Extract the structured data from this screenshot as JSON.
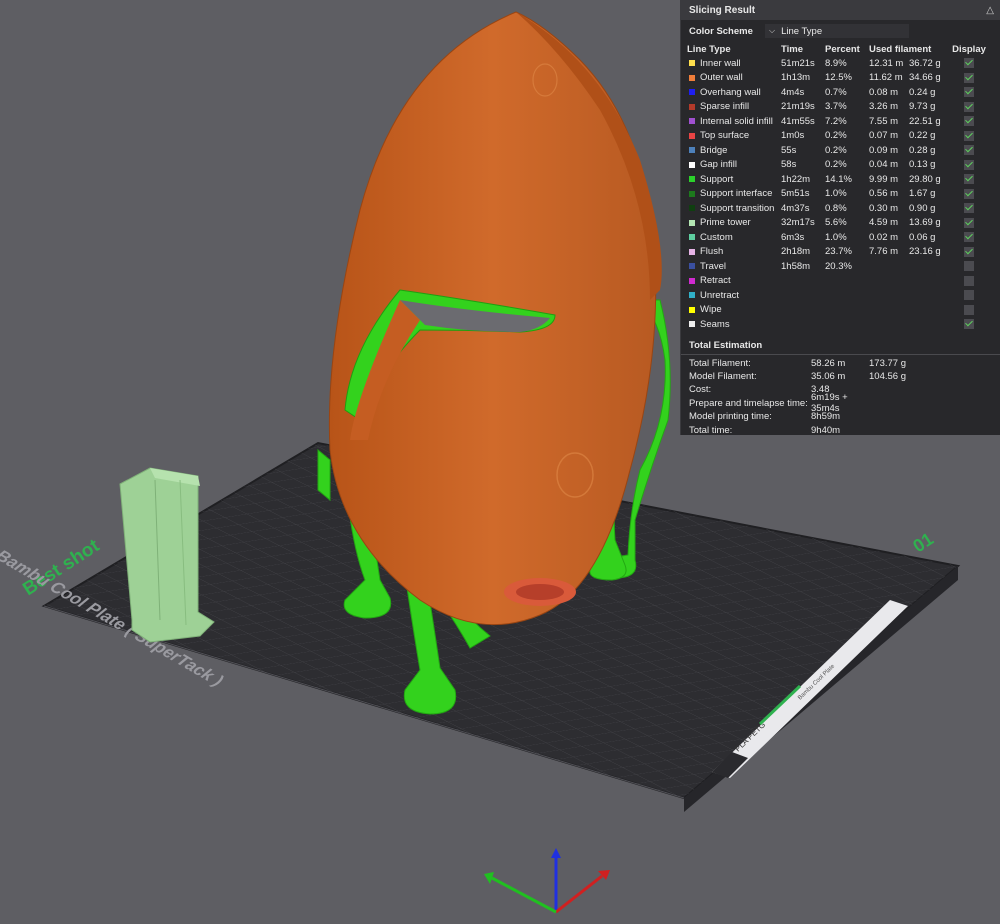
{
  "viewport": {
    "plate_brand_text": "Bambu Cool Plate ( SuperTack )",
    "plate_label": "Best shot",
    "plate_number": "01",
    "plate_sticker_text": "PLA PETG",
    "plate_sticker_small_text": "Bambu Cool Plate",
    "colors": {
      "background": "#5e5e63",
      "bed": "#2d2d31",
      "model_orange": "#c85f22",
      "support_green": "#33d21d",
      "prime_tower": "#9ed196",
      "label_green": "#2fb14f"
    }
  },
  "panel": {
    "title": "Slicing Result",
    "collapse_icon": "chevron-up-icon",
    "color_scheme_label": "Color Scheme",
    "color_scheme_value": "Line Type",
    "columns": [
      "Line Type",
      "Time",
      "Percent",
      "Used filament",
      "Display"
    ],
    "rows": [
      {
        "name": "Inner wall",
        "time": "51m21s",
        "percent": "8.9%",
        "used_m": "12.31 m",
        "used_g": "36.72 g",
        "color": "#ffdf4e",
        "display": true
      },
      {
        "name": "Outer wall",
        "time": "1h13m",
        "percent": "12.5%",
        "used_m": "11.62 m",
        "used_g": "34.66 g",
        "color": "#f07e3a",
        "display": true
      },
      {
        "name": "Overhang wall",
        "time": "4m4s",
        "percent": "0.7%",
        "used_m": "0.08 m",
        "used_g": "0.24 g",
        "color": "#1f1ff0",
        "display": true
      },
      {
        "name": "Sparse infill",
        "time": "21m19s",
        "percent": "3.7%",
        "used_m": "3.26 m",
        "used_g": "9.73 g",
        "color": "#b33a2a",
        "display": true
      },
      {
        "name": "Internal solid infill",
        "time": "41m55s",
        "percent": "7.2%",
        "used_m": "7.55 m",
        "used_g": "22.51 g",
        "color": "#a050d0",
        "display": true
      },
      {
        "name": "Top surface",
        "time": "1m0s",
        "percent": "0.2%",
        "used_m": "0.07 m",
        "used_g": "0.22 g",
        "color": "#e84444",
        "display": true
      },
      {
        "name": "Bridge",
        "time": "55s",
        "percent": "0.2%",
        "used_m": "0.09 m",
        "used_g": "0.28 g",
        "color": "#4d80ba",
        "display": true
      },
      {
        "name": "Gap infill",
        "time": "58s",
        "percent": "0.2%",
        "used_m": "0.04 m",
        "used_g": "0.13 g",
        "color": "#ffffff",
        "display": true
      },
      {
        "name": "Support",
        "time": "1h22m",
        "percent": "14.1%",
        "used_m": "9.99 m",
        "used_g": "29.80 g",
        "color": "#2bd12b",
        "display": true
      },
      {
        "name": "Support interface",
        "time": "5m51s",
        "percent": "1.0%",
        "used_m": "0.56 m",
        "used_g": "1.67 g",
        "color": "#1d7a1d",
        "display": true
      },
      {
        "name": "Support transition",
        "time": "4m37s",
        "percent": "0.8%",
        "used_m": "0.30 m",
        "used_g": "0.90 g",
        "color": "#0f3f10",
        "display": true
      },
      {
        "name": "Prime tower",
        "time": "32m17s",
        "percent": "5.6%",
        "used_m": "4.59 m",
        "used_g": "13.69 g",
        "color": "#b3e6b3",
        "display": true
      },
      {
        "name": "Custom",
        "time": "6m3s",
        "percent": "1.0%",
        "used_m": "0.02 m",
        "used_g": "0.06 g",
        "color": "#5ecfa0",
        "display": true
      },
      {
        "name": "Flush",
        "time": "2h18m",
        "percent": "23.7%",
        "used_m": "7.76 m",
        "used_g": "23.16 g",
        "color": "#e6b3e6",
        "display": true
      },
      {
        "name": "Travel",
        "time": "1h58m",
        "percent": "20.3%",
        "used_m": "",
        "used_g": "",
        "color": "#3a4fa0",
        "display": false
      },
      {
        "name": "Retract",
        "time": "",
        "percent": "",
        "used_m": "",
        "used_g": "",
        "color": "#d02ad0",
        "display": false
      },
      {
        "name": "Unretract",
        "time": "",
        "percent": "",
        "used_m": "",
        "used_g": "",
        "color": "#30b0c8",
        "display": false
      },
      {
        "name": "Wipe",
        "time": "",
        "percent": "",
        "used_m": "",
        "used_g": "",
        "color": "#ffff00",
        "display": false
      },
      {
        "name": "Seams",
        "time": "",
        "percent": "",
        "used_m": "",
        "used_g": "",
        "color": "#eeeeee",
        "display": true
      }
    ],
    "total_title": "Total Estimation",
    "totals": [
      {
        "label": "Total Filament:",
        "v1": "58.26 m",
        "v2": "173.77 g"
      },
      {
        "label": "Model Filament:",
        "v1": "35.06 m",
        "v2": "104.56 g"
      },
      {
        "label": "Cost:",
        "v1": "3.48",
        "v2": ""
      },
      {
        "label": "Prepare and timelapse time:",
        "v1": "6m19s + 35m4s",
        "v2": ""
      },
      {
        "label": "Model printing time:",
        "v1": "8h59m",
        "v2": ""
      },
      {
        "label": "Total time:",
        "v1": "9h40m",
        "v2": ""
      }
    ]
  }
}
